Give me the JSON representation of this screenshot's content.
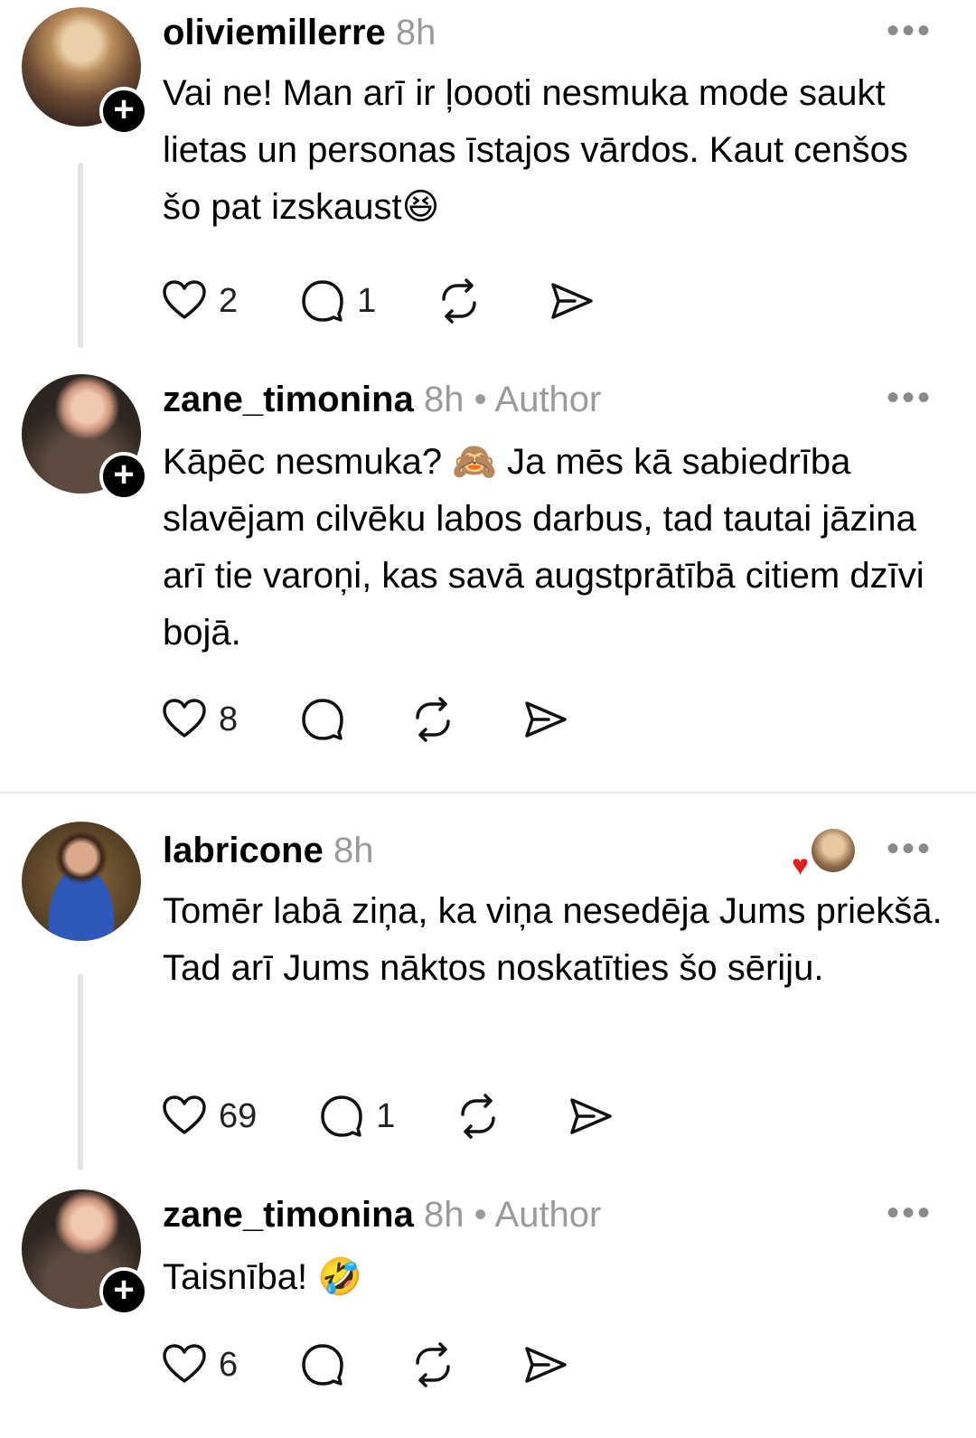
{
  "posts": [
    {
      "username": "oliviemillerre",
      "time": "8h",
      "text": "Vai ne! Man arī ir ļoooti nesmuka mode saukt lietas un personas īstajos vārdos. Kaut cenšos šo pat izskaust😆",
      "likes": "2",
      "replies": "1"
    },
    {
      "username": "zane_timonina",
      "time": "8h",
      "author_label": "Author",
      "text": "Kāpēc nesmuka? 🙈 Ja mēs kā sabiedrība slavējam cilvēku labos darbus, tad tautai jāzina arī tie varoņi, kas savā augstprātībā citiem dzīvi bojā.",
      "likes": "8"
    },
    {
      "username": "labricone",
      "time": "8h",
      "text": "Tomēr labā ziņa, ka viņa nesedēja Jums priekšā. Tad arī Jums nāktos noskatīties šo sēriju.",
      "likes": "69",
      "replies": "1"
    },
    {
      "username": "zane_timonina",
      "time": "8h",
      "author_label": "Author",
      "text": "Taisnība! 🤣",
      "likes": "6"
    }
  ],
  "separator": "•",
  "more_label": "•••",
  "follow_symbol": "+",
  "icons": [
    "heart-icon",
    "comment-icon",
    "repost-icon",
    "share-icon",
    "more-icon",
    "follow-plus-icon"
  ]
}
